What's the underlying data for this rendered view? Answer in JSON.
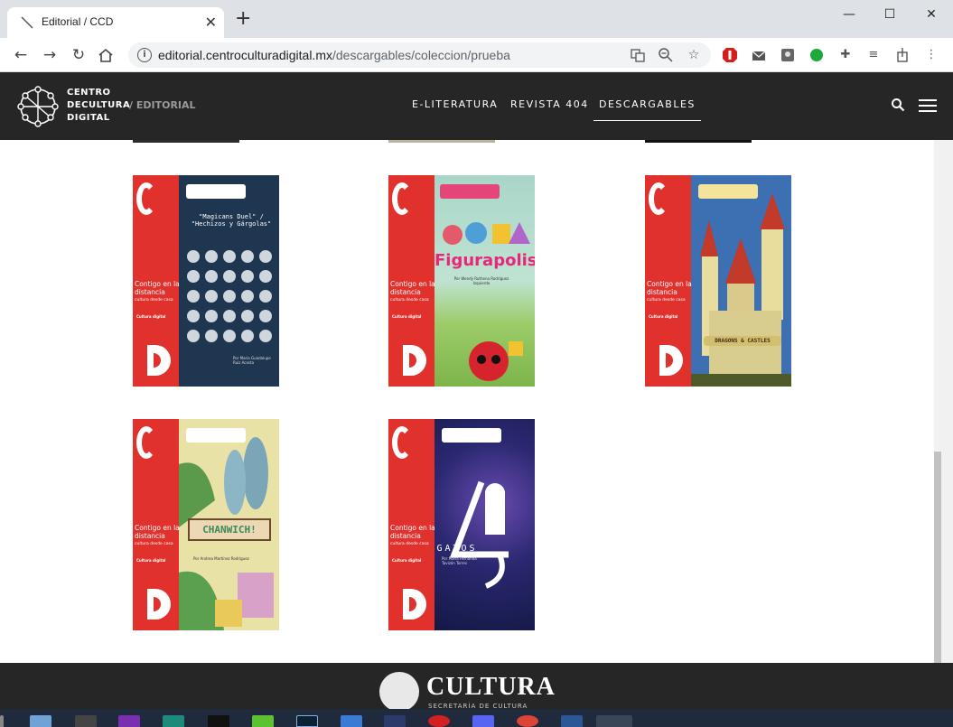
{
  "browser": {
    "tab_title": "Editorial / CCD",
    "tab_close": "✕",
    "new_tab": "+",
    "url_domain": "editorial.centroculturadigital.mx",
    "url_path": "/descargables/coleccion/prueba",
    "window_controls": {
      "minimize": "—",
      "maximize": "☐",
      "close": "✕"
    }
  },
  "site": {
    "logo_lines": [
      "CENTRO",
      "DECULTURA",
      "DIGITAL"
    ],
    "logo_sub": "/ EDITORIAL",
    "nav": [
      {
        "label": "E-LITERATURA"
      },
      {
        "label": "REVISTA 404"
      },
      {
        "label": "DESCARGABLES",
        "active": true
      }
    ]
  },
  "covers": [
    {
      "title": "\"Magicans Duel\" / \"Hechizos y Gárgolas\"",
      "contigo": "Contigo en la distancia",
      "sub": "cultura desde casa",
      "author": "Por María Guadalupe Ruiz Acosta",
      "brand": "Cultura digital"
    },
    {
      "title": "Figurapolis",
      "contigo": "Contigo en la distancia",
      "sub": "cultura desde casa",
      "author": "Por Wendy Ruthena Rodríguez Izquierdo",
      "brand": "Cultura digital"
    },
    {
      "title": "DRAGONS & CASTLES",
      "contigo": "Contigo en la distancia",
      "sub": "cultura desde casa",
      "author": "",
      "brand": "Cultura digital"
    },
    {
      "title": "CHANWICH!",
      "contigo": "Contigo en la distancia",
      "sub": "cultura desde casa",
      "author": "Por Andrea Martínez Rodríguez",
      "brand": "Cultura digital"
    },
    {
      "title": "GATOS",
      "contigo": "Contigo en la distancia",
      "sub": "cultura desde casa",
      "author": "Por María Fernanda Tavizón Torres",
      "brand": "Cultura digital"
    }
  ],
  "footer": {
    "title": "CULTURA",
    "subtitle": "SECRETARÍA DE CULTURA"
  },
  "colors": {
    "header_bg": "#262626",
    "spine_red": "#e0312d",
    "taskbar": "#1f2a3d"
  }
}
